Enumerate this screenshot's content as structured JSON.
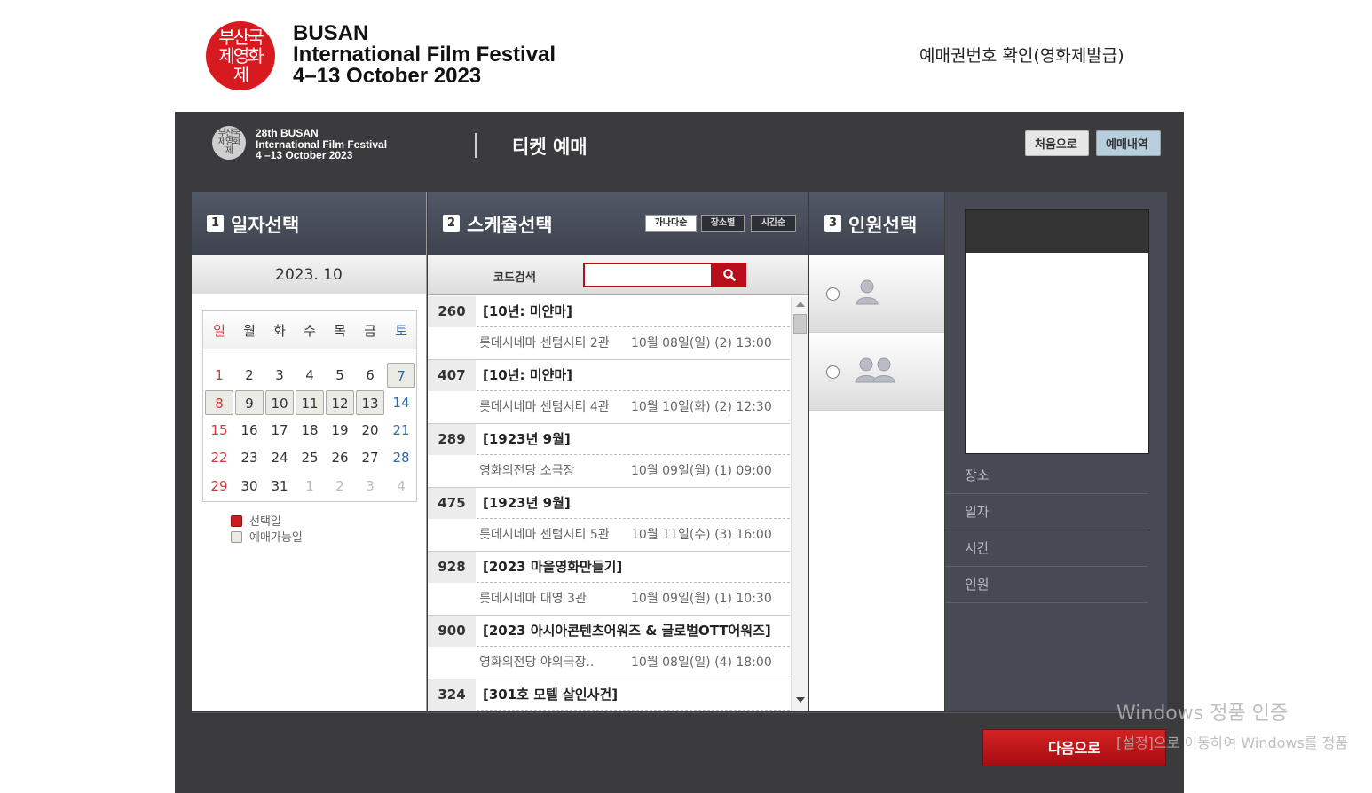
{
  "header": {
    "logo_glyphs": "부산국제영화제",
    "festival_line1": "BUSAN",
    "festival_line2": "International Film Festival",
    "festival_line3": "4–13 October 2023",
    "ticket_check_link": "예매권번호 확인(영화제발급)"
  },
  "frame": {
    "logo_glyphs": "부산국제영화제",
    "logo_line1": "28th BUSAN",
    "logo_line2": "International Film Festival",
    "logo_line3": "4 –13 October 2023",
    "title": "티켓 예매",
    "home_button": "처음으로",
    "history_button": "예매내역"
  },
  "steps": {
    "date": {
      "num": "1",
      "title": "일자선택"
    },
    "schedule": {
      "num": "2",
      "title": "스케쥴선택"
    },
    "people": {
      "num": "3",
      "title": "인원선택"
    }
  },
  "calendar": {
    "month_label": "2023. 10",
    "weekdays": [
      "일",
      "월",
      "화",
      "수",
      "목",
      "금",
      "토"
    ],
    "weeks": [
      [
        "1",
        "2",
        "3",
        "4",
        "5",
        "6",
        "7"
      ],
      [
        "8",
        "9",
        "10",
        "11",
        "12",
        "13",
        "14"
      ],
      [
        "15",
        "16",
        "17",
        "18",
        "19",
        "20",
        "21"
      ],
      [
        "22",
        "23",
        "24",
        "25",
        "26",
        "27",
        "28"
      ],
      [
        "29",
        "30",
        "31",
        "1",
        "2",
        "3",
        "4"
      ]
    ],
    "available_days": [
      "7",
      "8",
      "9",
      "10",
      "11",
      "12",
      "13"
    ],
    "legend_selected": "선택일",
    "legend_available": "예매가능일"
  },
  "schedule": {
    "sort_by_name": "가나다순",
    "sort_by_place": "장소별",
    "sort_by_time": "시간순",
    "search_label": "코드검색",
    "search_value": "",
    "items": [
      {
        "code": "260",
        "title": "[10년: 미얀마]",
        "venue": "롯데시네마 센텀시티 2관",
        "datetime": "10월 08일(일) (2) 13:00"
      },
      {
        "code": "407",
        "title": "[10년: 미얀마]",
        "venue": "롯데시네마 센텀시티 4관",
        "datetime": "10월 10일(화) (2) 12:30"
      },
      {
        "code": "289",
        "title": "[1923년 9월]",
        "venue": "영화의전당 소극장",
        "datetime": "10월 09일(월) (1) 09:00"
      },
      {
        "code": "475",
        "title": "[1923년 9월]",
        "venue": "롯데시네마 센텀시티 5관",
        "datetime": "10월 11일(수) (3) 16:00"
      },
      {
        "code": "928",
        "title": "[2023 마을영화만들기]",
        "venue": "롯데시네마 대영 3관",
        "datetime": "10월 09일(월) (1) 10:30"
      },
      {
        "code": "900",
        "title": "[2023 아시아콘텐츠어워즈 & 글로벌OTT어워즈]",
        "venue": "영화의전당 야외극장..",
        "datetime": "10월 08일(일) (4) 18:00"
      },
      {
        "code": "324",
        "title": "[301호 모텔 살인사건]",
        "venue": "",
        "datetime": ""
      }
    ]
  },
  "summary": {
    "venue_label": "장소",
    "date_label": "일자",
    "time_label": "시간",
    "people_label": "인원"
  },
  "footer": {
    "next_button": "다음으로"
  },
  "watermark": {
    "title": "Windows 정품 인증",
    "subtitle": "[설정]으로 이동하여 Windows를 정품"
  },
  "colors": {
    "brand_red": "#d71920",
    "frame_bg": "#3b3b3d",
    "panel_head": "#4a4f5c",
    "next_button": "#c01a1a"
  }
}
